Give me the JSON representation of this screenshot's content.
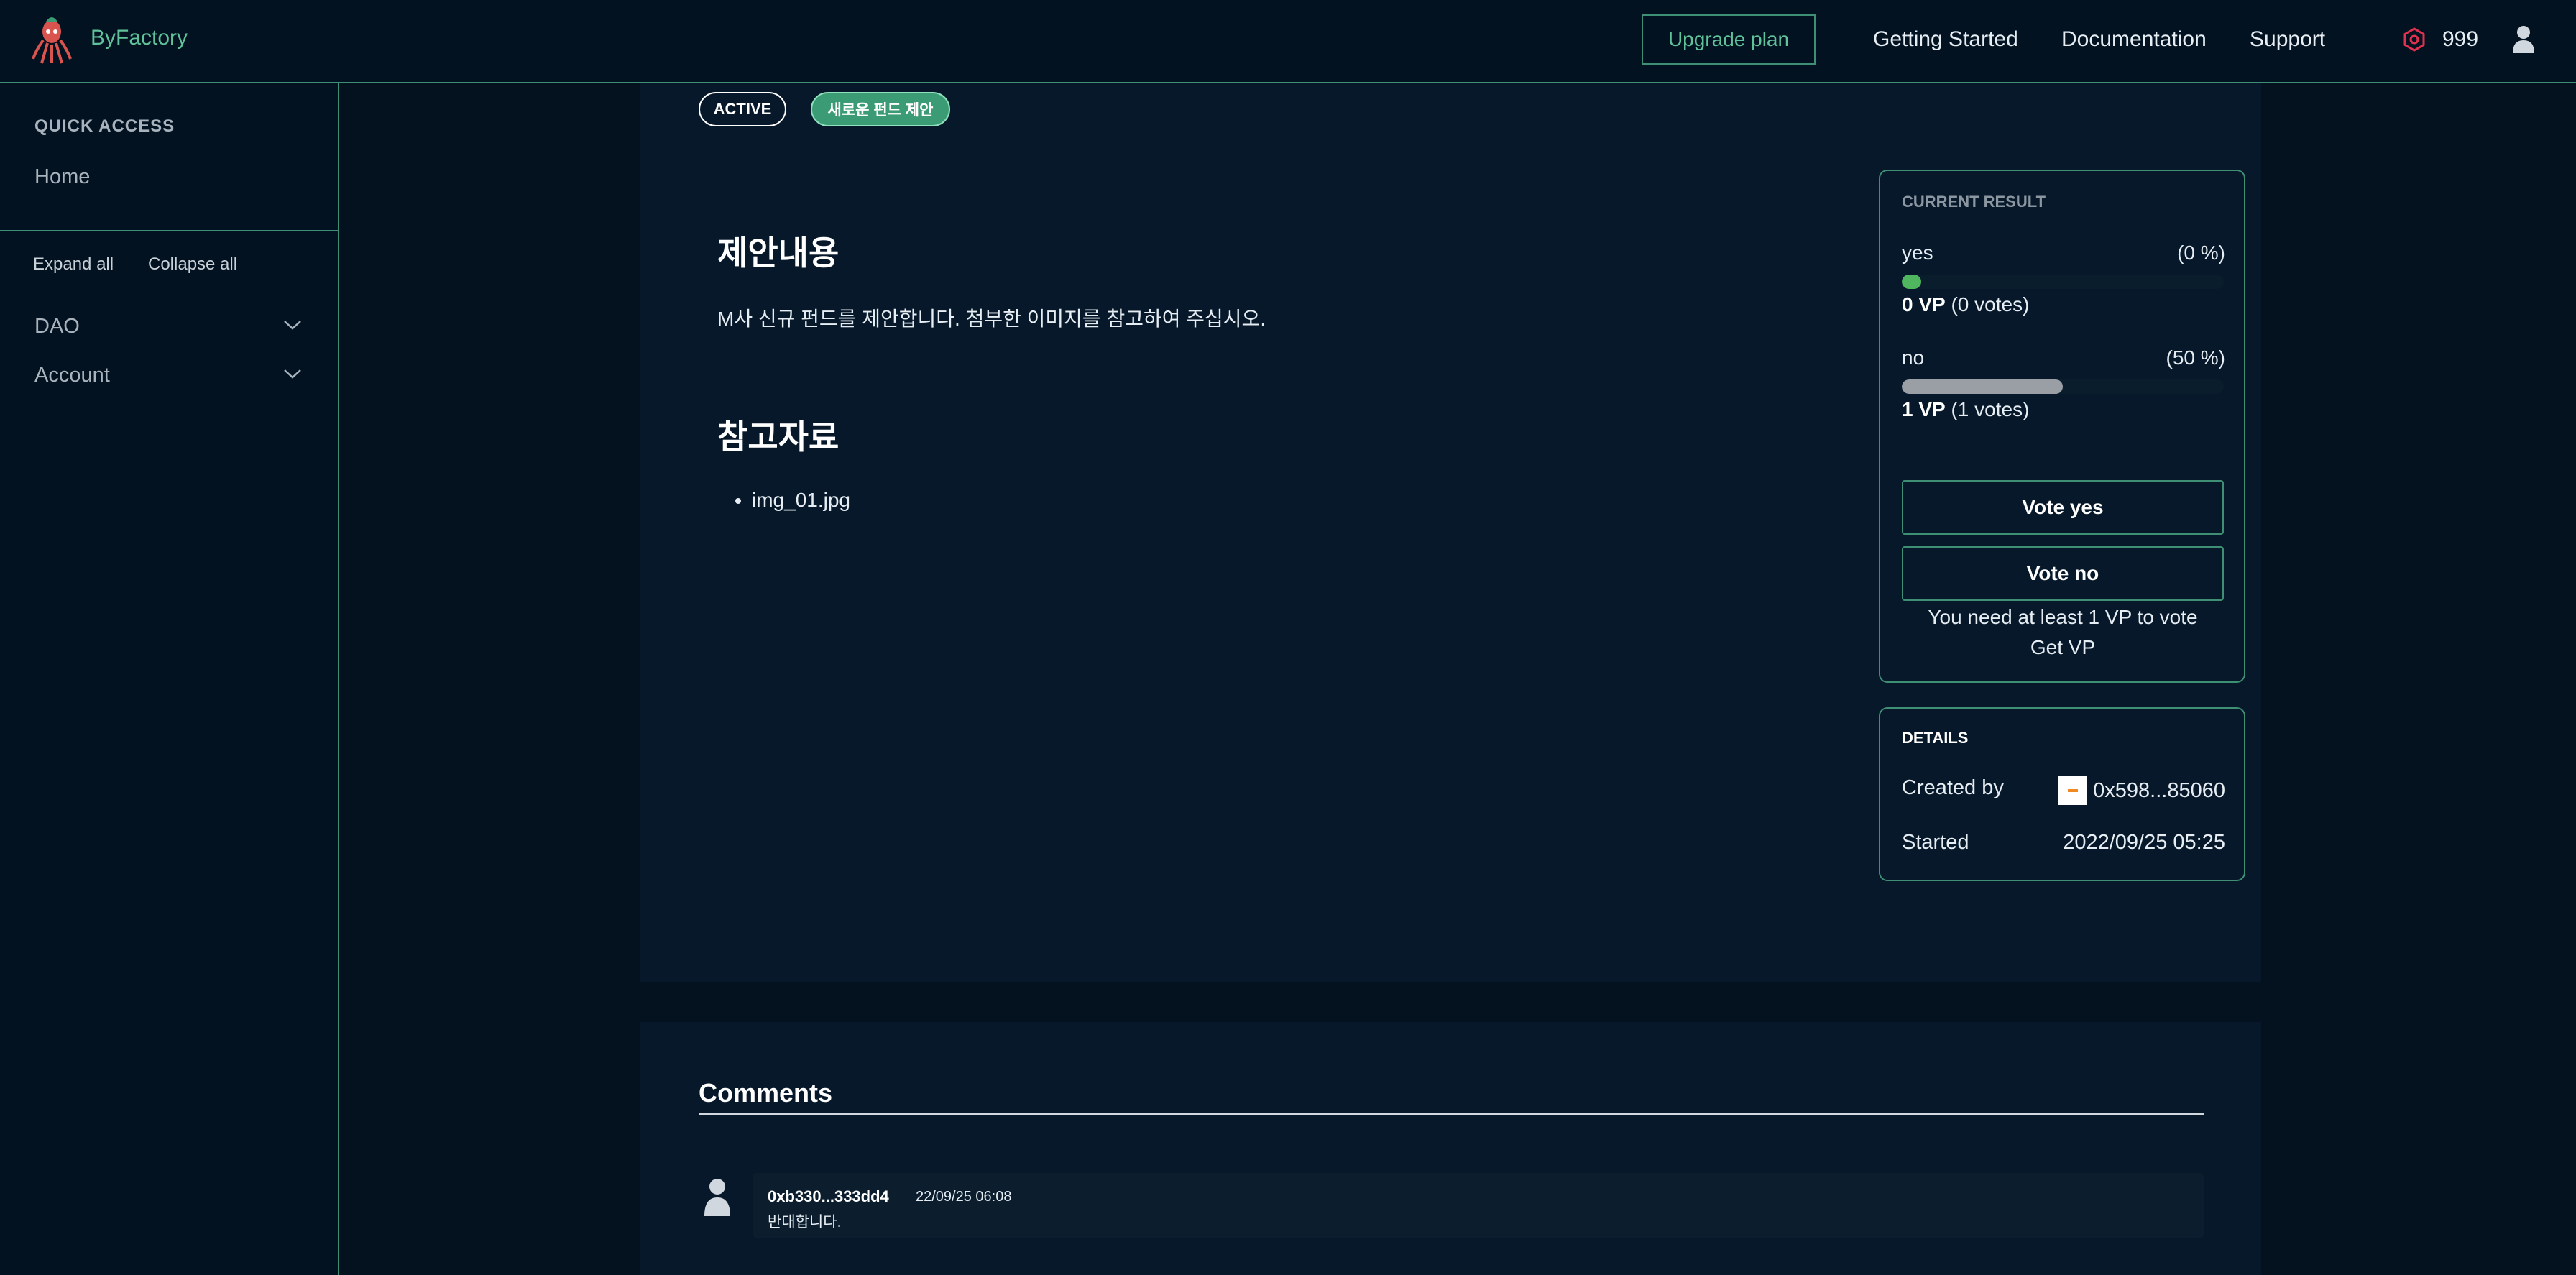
{
  "header": {
    "brand": "ByFactory",
    "upgrade_label": "Upgrade plan",
    "nav": [
      "Getting Started",
      "Documentation",
      "Support"
    ],
    "token_count": "999",
    "icons": {
      "logo": "octopus-logo-icon",
      "token": "hexagon-token-icon",
      "user": "user-icon"
    }
  },
  "sidebar": {
    "quick_access_title": "QUICK ACCESS",
    "home": "Home",
    "expand_all": "Expand all",
    "collapse_all": "Collapse all",
    "groups": [
      "DAO",
      "Account"
    ]
  },
  "proposal": {
    "status_badge": "ACTIVE",
    "topic_badge": "새로운 펀드 제안",
    "content_heading": "제안내용",
    "content_text": "M사 신규 펀드를 제안합니다. 첨부한 이미지를 참고하여 주십시오.",
    "reference_heading": "참고자료",
    "references": [
      "img_01.jpg"
    ]
  },
  "result": {
    "title": "CURRENT RESULT",
    "choices": [
      {
        "label": "yes",
        "percent_text": "(0 %)",
        "vp_bold": "0 VP",
        "votes_text": " (0 votes)",
        "bar_fraction": 0.06,
        "bar_color": "#4fb65f"
      },
      {
        "label": "no",
        "percent_text": "(50 %)",
        "vp_bold": "1 VP",
        "votes_text": " (1 votes)",
        "bar_fraction": 0.5,
        "bar_color": "#9a9fa5"
      }
    ],
    "vote_yes_label": "Vote yes",
    "vote_no_label": "Vote no",
    "note": "You need at least 1 VP to vote",
    "get_vp": "Get VP"
  },
  "details": {
    "title": "DETAILS",
    "created_by_label": "Created by",
    "created_by_value": "0x598...85060",
    "started_label": "Started",
    "started_value": "2022/09/25 05:25"
  },
  "comments": {
    "title": "Comments",
    "items": [
      {
        "author": "0xb330...333dd4",
        "time": "22/09/25 06:08",
        "text": "반대합니다."
      }
    ]
  },
  "colors": {
    "accent": "#3f8f74",
    "accent_text": "#5fc29a",
    "background": "#04121f",
    "panel": "#061829"
  }
}
